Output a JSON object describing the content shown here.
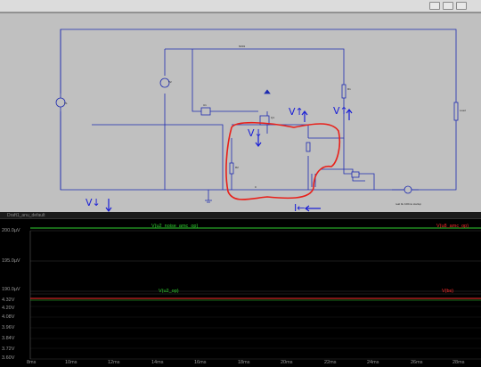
{
  "window": {
    "waveform_title": "Draft1_anu_default"
  },
  "schematic": {
    "annotations": {
      "v_left": "V↓",
      "v_mid": "V↓",
      "v_top_center": "V↑",
      "v_top_right": "V↑",
      "current": "I←"
    },
    "labels": {
      "v1": "V1",
      "v2": "V2",
      "r1": "R1",
      "r2": "R2",
      "u1": "U1",
      "q1": "Q1",
      "load": "Load",
      "net_top": "N001",
      "net_bottom": "0",
      "cmd": "real 0u 100ms startup"
    },
    "colors": {
      "wire": "#1d2ab0",
      "highlight": "#e8201a",
      "annotation": "#1a1fd6"
    }
  },
  "waveform": {
    "pane1": {
      "trace_left": "V(u2_noise_amc_op)",
      "trace_right": "V(u8_amc_op)",
      "yticks": [
        "200.0µV",
        "195.0µV",
        "190.0µV"
      ]
    },
    "pane2": {
      "trace_left": "V(u2_op)",
      "trace_right": "V(bs)",
      "yticks": [
        "4.32V",
        "4.20V",
        "4.08V",
        "3.96V",
        "3.84V",
        "3.72V",
        "3.60V"
      ]
    },
    "xticks": [
      "8ms",
      "10ms",
      "12ms",
      "14ms",
      "16ms",
      "18ms",
      "20ms",
      "22ms",
      "24ms",
      "26ms",
      "28ms"
    ],
    "colors": {
      "green": "#2fd12f",
      "red": "#ff2b2b",
      "grid": "#3a3a3a"
    }
  }
}
